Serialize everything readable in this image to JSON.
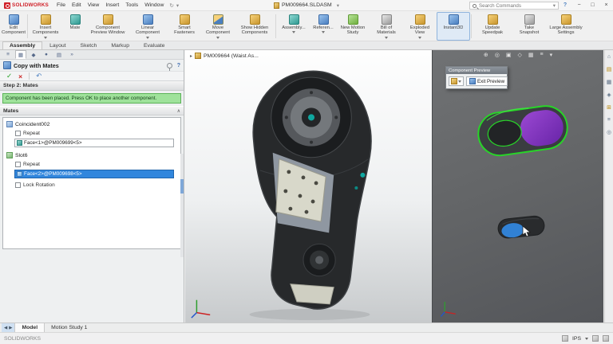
{
  "title_bar": {
    "logo_text": "SOLIDWORKS",
    "menus": [
      "File",
      "Edit",
      "View",
      "Insert",
      "Tools",
      "Window"
    ],
    "document_title": "PM009664.SLDASM",
    "search_placeholder": "Search Commands"
  },
  "ribbon": {
    "buttons": [
      "Edit Component",
      "Insert Components",
      "Mate",
      "Component Preview Window",
      "Linear Component Pattern",
      "Smart Fasteners",
      "Move Component",
      "Show Hidden Components",
      "Assembly...",
      "Referen...",
      "New Motion Study",
      "Bill of Materials",
      "Exploded View",
      "Instant3D",
      "Update Speedpak Subassemblies",
      "Take Snapshot",
      "Large Assembly Settings"
    ]
  },
  "command_tabs": [
    "Assembly",
    "Layout",
    "Sketch",
    "Markup",
    "Evaluate"
  ],
  "feature_tabs": [
    "≡",
    "▦",
    "◆",
    "●",
    "▤",
    "»"
  ],
  "property_manager": {
    "title": "Copy with Mates",
    "step_label": "Step 2: Mates",
    "message": "Component has been placed. Press OK to place another component.",
    "mates_label": "Mates",
    "mate1_name": "Coincident002",
    "repeat_label": "Repeat",
    "mate1_face": "Face<1>@PM009699<5>",
    "mate2_name": "Slot6",
    "repeat2_label": "Repeat",
    "mate2_face": "Face<2>@PM009698<5>",
    "lock_rotation_label": "Lock Rotation"
  },
  "viewport": {
    "assembly_label": "PM009664 (Waist As..."
  },
  "preview": {
    "window_title": "Component Preview",
    "exit_button": "Exit Preview",
    "toolbar_icons": [
      "⊕",
      "◎",
      "▣",
      "◇",
      "▦",
      "≡",
      "▾"
    ]
  },
  "task_pane": {
    "icons": [
      "⌂",
      "▤",
      "▦",
      "◈",
      "⊞",
      "≡",
      "◎"
    ]
  },
  "bottom_tabs": [
    "Model",
    "Motion Study 1"
  ],
  "status_bar": {
    "app_name": "SOLIDWORKS",
    "units": "IPS"
  },
  "icons": {
    "minimize": "−",
    "maximize": "□",
    "close": "×",
    "check": "✓",
    "cross": "×",
    "undo": "↶",
    "help": "?",
    "collapse": "∧",
    "flyout": "▸",
    "nav_left": "◀",
    "nav_right": "▶",
    "qat_refresh": "↻",
    "qat_caret": "▾"
  },
  "colors": {
    "accent_blue": "#3186dd",
    "highlight_green": "#28d428",
    "highlight_purple": "#8a2fd0",
    "message_green": "#9fe29b",
    "logo_red": "#d02028"
  }
}
